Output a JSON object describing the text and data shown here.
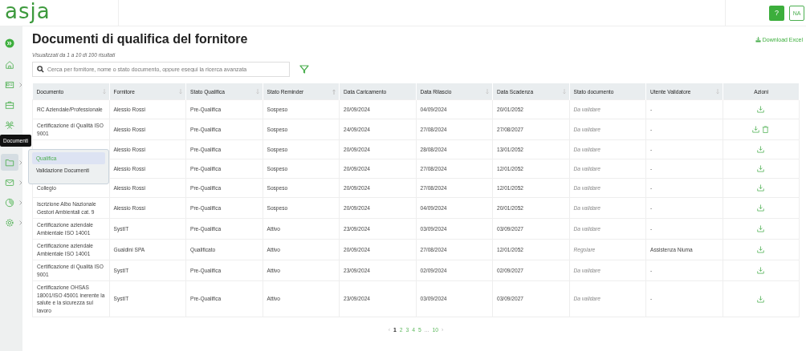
{
  "header": {
    "logo": "asja",
    "help_button": "?",
    "user_initials": "NA"
  },
  "sidebar": {
    "items": [
      {
        "kind": "expand",
        "selected": false,
        "has_submenu": false
      },
      {
        "kind": "home",
        "selected": false,
        "has_submenu": false
      },
      {
        "kind": "id-card",
        "selected": false,
        "has_submenu": true
      },
      {
        "kind": "briefcase",
        "selected": false,
        "has_submenu": false
      },
      {
        "kind": "people",
        "selected": false,
        "has_submenu": false
      },
      {
        "kind": "folder",
        "selected": true,
        "has_submenu": true,
        "tooltip": "Documenti"
      },
      {
        "kind": "mail",
        "selected": false,
        "has_submenu": true
      },
      {
        "kind": "pie-chart",
        "selected": false,
        "has_submenu": true
      },
      {
        "kind": "gear",
        "selected": false,
        "has_submenu": true
      }
    ]
  },
  "submenu": {
    "items": [
      {
        "label": "Qualifica",
        "selected": true
      },
      {
        "label": "Validazione Documenti",
        "selected": false
      }
    ]
  },
  "page": {
    "title": "Documenti di qualifica del fornitore",
    "results_info": "Visualizzati da 1 a 10 di 100 risultati",
    "download_link": "Download Excel"
  },
  "search": {
    "placeholder": "Cerca per fornitore, nome o stato documento, oppure esegui la ricerca avanzata"
  },
  "table": {
    "columns": [
      {
        "label": "Documento",
        "kind": "text",
        "sortable": true,
        "sorted": false
      },
      {
        "label": "Fornitore",
        "kind": "text",
        "sortable": true,
        "sorted": false
      },
      {
        "label": "Stato Qualifica",
        "kind": "text",
        "sortable": true,
        "sorted": false
      },
      {
        "label": "Stato Reminder",
        "kind": "text",
        "sortable": true,
        "sorted": true
      },
      {
        "label": "Data Caricamento",
        "kind": "text",
        "sortable": false
      },
      {
        "label": "Data Rilascio",
        "kind": "text",
        "sortable": true,
        "sorted": false
      },
      {
        "label": "Data Scadenza",
        "kind": "text",
        "sortable": true,
        "sorted": false
      },
      {
        "label": "Stato documento",
        "kind": "status",
        "sortable": false
      },
      {
        "label": "Utente Validatore",
        "kind": "text",
        "sortable": true,
        "sorted": false
      },
      {
        "label": "Azioni",
        "kind": "actions",
        "sortable": false
      }
    ],
    "rows": [
      {
        "cells": [
          "RC Aziendale/Professionale",
          "Alessio Rossi",
          "Pre-Qualifica",
          "Sospeso",
          "20/09/2024",
          "04/09/2024",
          "20/01/2052",
          "Da validare",
          "-"
        ],
        "actions": [
          {
            "kind": "download"
          }
        ]
      },
      {
        "cells": [
          "Certificazione di Qualità ISO 9001",
          "Alessio Rossi",
          "Pre-Qualifica",
          "Sospeso",
          "24/09/2024",
          "27/08/2024",
          "27/08/2027",
          "Da validare",
          "-"
        ],
        "actions": [
          {
            "kind": "download"
          },
          {
            "kind": "delete"
          }
        ]
      },
      {
        "cells": [
          "",
          "Alessio Rossi",
          "Pre-Qualifica",
          "Sospeso",
          "20/09/2024",
          "28/08/2024",
          "13/01/2052",
          "Da validare",
          "-"
        ],
        "actions": [
          {
            "kind": "download"
          }
        ]
      },
      {
        "cells": [
          "",
          "Alessio Rossi",
          "Pre-Qualifica",
          "Sospeso",
          "20/09/2024",
          "27/08/2024",
          "12/01/2052",
          "Da validare",
          "-"
        ],
        "actions": [
          {
            "kind": "download"
          }
        ]
      },
      {
        "cells": [
          "Collegio",
          "Alessio Rossi",
          "Pre-Qualifica",
          "Sospeso",
          "20/09/2024",
          "27/08/2024",
          "12/01/2052",
          "Da validare",
          "-"
        ],
        "actions": [
          {
            "kind": "download"
          }
        ]
      },
      {
        "cells": [
          "Iscrizione Albo Nazionale Gestori Ambientali cat. 9",
          "Alessio Rossi",
          "Pre-Qualifica",
          "Sospeso",
          "20/09/2024",
          "04/09/2024",
          "20/01/2052",
          "Da validare",
          "-"
        ],
        "actions": [
          {
            "kind": "download"
          }
        ]
      },
      {
        "cells": [
          "Certificazione aziendale Ambientale ISO 14001",
          "SystIT",
          "Pre-Qualifica",
          "Attivo",
          "23/09/2024",
          "03/09/2024",
          "03/09/2027",
          "Da validare",
          "-"
        ],
        "actions": [
          {
            "kind": "download"
          }
        ]
      },
      {
        "cells": [
          "Certificazione aziendale Ambientale ISO 14001",
          "Gualdini SPA",
          "Qualificato",
          "Attivo",
          "20/09/2024",
          "27/08/2024",
          "12/01/2052",
          "Regolare",
          "Assistenza Niuma"
        ],
        "actions": [
          {
            "kind": "download"
          }
        ]
      },
      {
        "cells": [
          "Certificazione di Qualità ISO 9001",
          "SystIT",
          "Pre-Qualifica",
          "Attivo",
          "23/09/2024",
          "02/09/2024",
          "02/09/2027",
          "Da validare",
          "-"
        ],
        "actions": [
          {
            "kind": "download"
          }
        ]
      },
      {
        "cells": [
          "Certificazione OHSAS 18001/ISO 45001 inerente la salute e la sicurezza sul lavoro",
          "SystIT",
          "Pre-Qualifica",
          "Attivo",
          "23/09/2024",
          "03/09/2024",
          "03/09/2027",
          "Da validare",
          "-"
        ],
        "actions": [
          {
            "kind": "download"
          }
        ]
      }
    ]
  },
  "pagination": [
    {
      "label": "‹",
      "kind": "prev"
    },
    {
      "label": "1",
      "kind": "page",
      "selected": true
    },
    {
      "label": "2",
      "kind": "page",
      "selected": false
    },
    {
      "label": "3",
      "kind": "page",
      "selected": false
    },
    {
      "label": "4",
      "kind": "page",
      "selected": false
    },
    {
      "label": "5",
      "kind": "page",
      "selected": false
    },
    {
      "label": "...",
      "kind": "gap"
    },
    {
      "label": "10",
      "kind": "page",
      "selected": false
    },
    {
      "label": "›",
      "kind": "next"
    }
  ]
}
